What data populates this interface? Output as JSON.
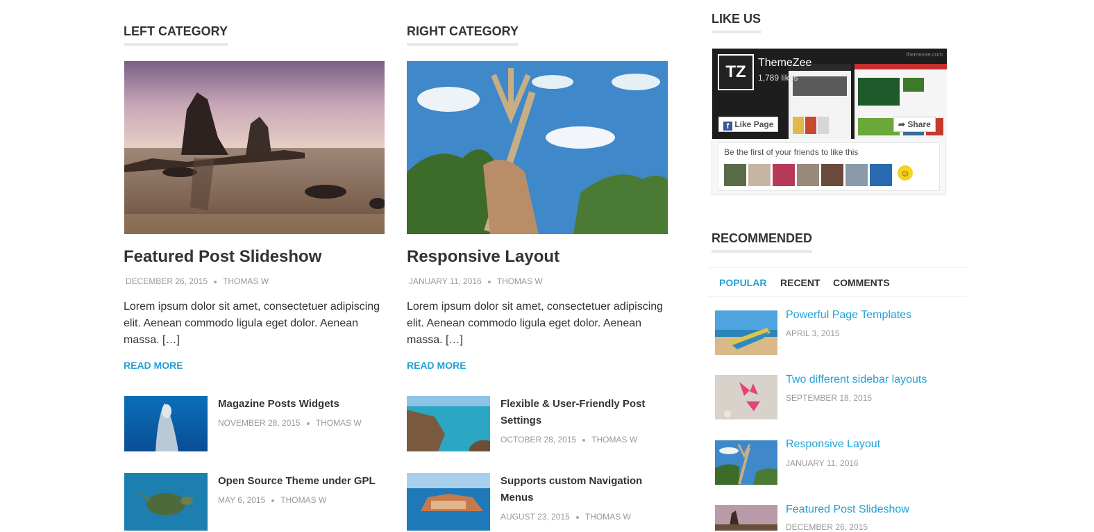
{
  "left_category": {
    "heading": "LEFT CATEGORY",
    "featured": {
      "title": "Featured Post Slideshow",
      "date": "DECEMBER 26, 2015",
      "author": "THOMAS W",
      "excerpt": "Lorem ipsum dolor sit amet, consectetuer adipiscing elit. Aenean commodo ligula eget dolor. Aenean massa. […]",
      "read_more": "READ MORE"
    },
    "posts": [
      {
        "title": "Magazine Posts Widgets",
        "date": "NOVEMBER 28, 2015",
        "author": "THOMAS W"
      },
      {
        "title": "Open Source Theme under GPL",
        "date": "MAY 6, 2015",
        "author": "THOMAS W"
      }
    ]
  },
  "right_category": {
    "heading": "RIGHT CATEGORY",
    "featured": {
      "title": "Responsive Layout",
      "date": "JANUARY 11, 2016",
      "author": "THOMAS W",
      "excerpt": "Lorem ipsum dolor sit amet, consectetuer adipiscing elit. Aenean commodo ligula eget dolor. Aenean massa. […]",
      "read_more": "READ MORE"
    },
    "posts": [
      {
        "title": "Flexible & User-Friendly Post Settings",
        "date": "OCTOBER 28, 2015",
        "author": "THOMAS W"
      },
      {
        "title": "Supports custom Navigation Menus",
        "date": "AUGUST 23, 2015",
        "author": "THOMAS W"
      }
    ]
  },
  "sidebar": {
    "like_us": {
      "heading": "LIKE US",
      "page_name": "ThemeZee",
      "likes": "1,789 likes",
      "logo_text": "TZ",
      "like_button": "Like Page",
      "share_button": "Share",
      "friends_text": "Be the first of your friends to like this",
      "cover_watermark": "themezee.com"
    },
    "recommended": {
      "heading": "RECOMMENDED",
      "tabs": [
        "POPULAR",
        "RECENT",
        "COMMENTS"
      ],
      "active_tab": "POPULAR",
      "posts": [
        {
          "title": "Powerful Page Templates",
          "date": "APRIL 3, 2015"
        },
        {
          "title": "Two different sidebar layouts",
          "date": "SEPTEMBER 18, 2015"
        },
        {
          "title": "Responsive Layout",
          "date": "JANUARY 11, 2016"
        },
        {
          "title": "Featured Post Slideshow",
          "date": "DECEMBER 26, 2015"
        }
      ]
    }
  },
  "colors": {
    "accent": "#22a0d6",
    "text": "#333333",
    "meta": "#999999",
    "facebook": "#3b5998"
  }
}
